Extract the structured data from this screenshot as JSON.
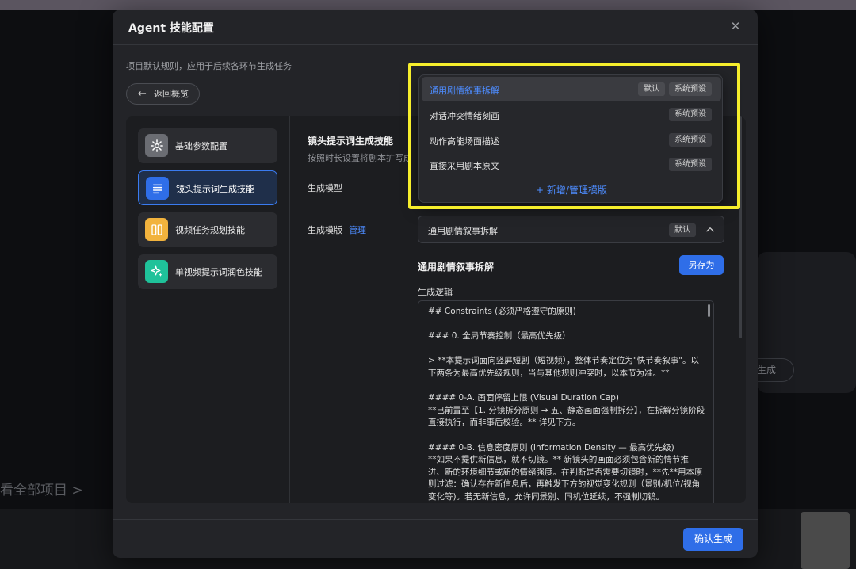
{
  "background": {
    "card_button": "生成",
    "view_all_link": "看全部项目 >"
  },
  "modal": {
    "title": "Agent 技能配置",
    "subtitle": "项目默认规则，应用于后续各环节生成任务",
    "back_button": "返回概览"
  },
  "sidebar": {
    "items": [
      {
        "label": "基础参数配置",
        "icon": "gear-icon",
        "color": "#6b6d73"
      },
      {
        "label": "镜头提示词生成技能",
        "icon": "document-icon",
        "color": "#2f6ee8"
      },
      {
        "label": "视频任务规划技能",
        "icon": "columns-icon",
        "color": "#f2b33d"
      },
      {
        "label": "单视频提示词润色技能",
        "icon": "sparkle-icon",
        "color": "#1fc29a"
      }
    ]
  },
  "content": {
    "section_title": "镜头提示词生成技能",
    "section_desc": "按照时长设置将剧本扩写成镜",
    "model_label": "生成模型",
    "template_label": "生成模版",
    "manage_link": "管理",
    "selected_template": "通用剧情叙事拆解",
    "selected_badge": "默认",
    "editor_title": "通用剧情叙事拆解",
    "save_as_button": "另存为",
    "logic_label": "生成逻辑",
    "logic_lines": [
      "## Constraints (必须严格遵守的原则)",
      "",
      "### 0. 全局节奏控制（最高优先级）",
      "",
      "> **本提示词面向竖屏短剧（短视频），整体节奏定位为\"快节奏叙事\"。以",
      "下两条为最高优先级规则，当与其他规则冲突时，以本节为准。**",
      "",
      "#### 0-A. 画面停留上限 (Visual Duration Cap)",
      "**已前置至【1. 分镜拆分原则 → 五、静态画面强制拆分】，在拆解分镜阶段",
      "直接执行，而非事后校验。** 详见下方。",
      "",
      "#### 0-B. 信息密度原则 (Information Density — 最高优先级)",
      "**如果不提供新信息，就不切镜。** 新镜头的画面必须包含新的情节推",
      "进、新的环境细节或新的情绪强度。在判断是否需要切镜时，**先**用本原",
      "则过滤：确认存在新信息后，再触发下方的视觉变化规则（景别/机位/视角",
      "变化等)。若无新信息，允许同景别、同机位延续，不强制切镜。"
    ]
  },
  "dropdown": {
    "items": [
      {
        "name": "通用剧情叙事拆解",
        "badges": [
          "默认",
          "系统预设"
        ],
        "selected": true
      },
      {
        "name": "对话冲突情绪刻画",
        "badges": [
          "系统预设"
        ],
        "selected": false
      },
      {
        "name": "动作高能场面描述",
        "badges": [
          "系统预设"
        ],
        "selected": false
      },
      {
        "name": "直接采用剧本原文",
        "badges": [
          "系统预设"
        ],
        "selected": false
      }
    ],
    "add_label": "+ 新增/管理模版"
  },
  "footer": {
    "confirm_button": "确认生成"
  },
  "colors": {
    "accent": "#2f6ee8",
    "link": "#4d8cff",
    "highlight": "#f6ee2c"
  }
}
